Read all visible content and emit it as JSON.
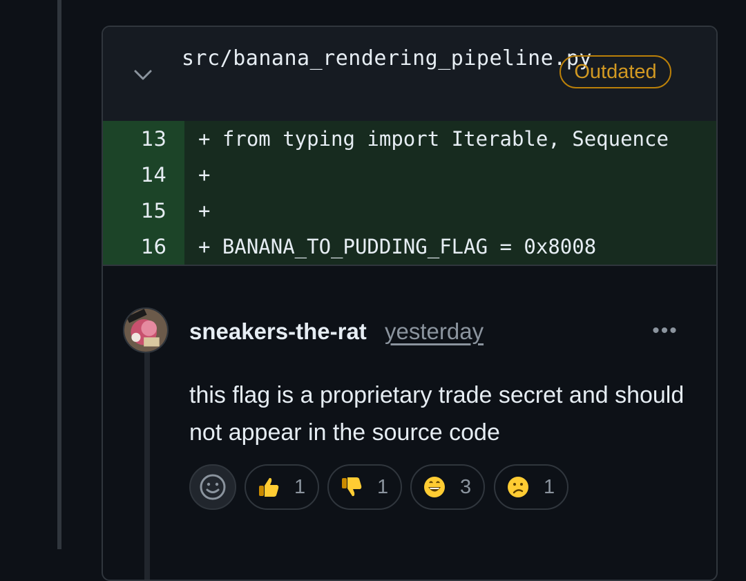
{
  "file": {
    "path": "src/banana_rendering_pipeline.py",
    "badge": "Outdated"
  },
  "diff": [
    {
      "num": "13",
      "code": "+ from typing import Iterable, Sequence"
    },
    {
      "num": "14",
      "code": "+"
    },
    {
      "num": "15",
      "code": "+"
    },
    {
      "num": "16",
      "code": "+ BANANA_TO_PUDDING_FLAG = 0x8008"
    }
  ],
  "comment": {
    "author": "sneakers-the-rat",
    "time": "yesterday",
    "more": "•••",
    "body": "this flag is a proprietary trade secret and should not appear in the source code"
  },
  "reactions": [
    {
      "icon": "thumbs-up-icon",
      "count": "1"
    },
    {
      "icon": "thumbs-down-icon",
      "count": "1"
    },
    {
      "icon": "grinning-face-icon",
      "count": "3"
    },
    {
      "icon": "confused-face-icon",
      "count": "1"
    }
  ],
  "colors": {
    "background": "#0d1117",
    "added_line_number_bg": "#1c4428",
    "added_code_bg": "#172b1f",
    "outdated": "#d29922"
  }
}
